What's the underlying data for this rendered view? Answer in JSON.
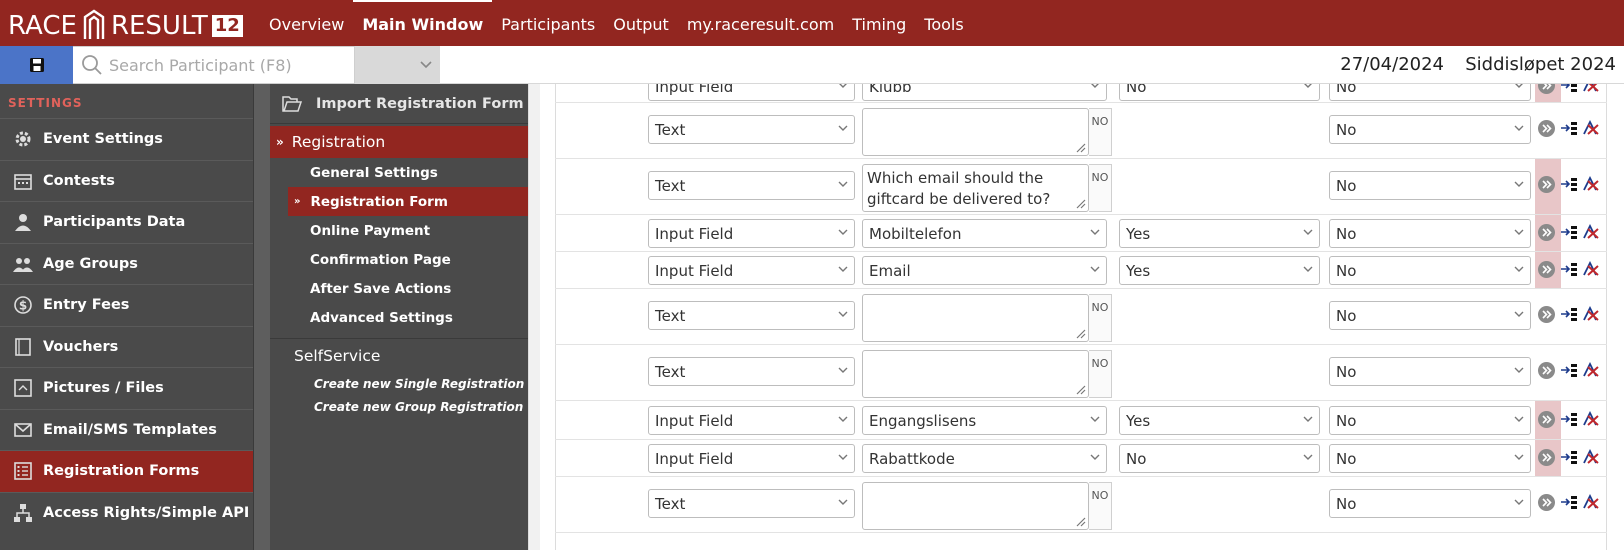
{
  "brand": {
    "logo_left": "RACE",
    "logo_right": "RESULT",
    "logo_version": "12"
  },
  "nav": [
    {
      "label": "Overview",
      "active": false
    },
    {
      "label": "Main Window",
      "active": true
    },
    {
      "label": "Participants",
      "active": false
    },
    {
      "label": "Output",
      "active": false
    },
    {
      "label": "my.raceresult.com",
      "active": false
    },
    {
      "label": "Timing",
      "active": false
    },
    {
      "label": "Tools",
      "active": false
    }
  ],
  "toolbar": {
    "search_placeholder": "Search Participant (F8)",
    "event_date": "27/04/2024",
    "event_name": "Siddisløpet 2024"
  },
  "sidebar": {
    "section": "SETTINGS",
    "items": [
      {
        "label": "Event Settings",
        "icon": "gear-icon"
      },
      {
        "label": "Contests",
        "icon": "calendar-icon"
      },
      {
        "label": "Participants Data",
        "icon": "person-icon"
      },
      {
        "label": "Age Groups",
        "icon": "group-icon"
      },
      {
        "label": "Entry Fees",
        "icon": "dollar-icon"
      },
      {
        "label": "Vouchers",
        "icon": "voucher-icon"
      },
      {
        "label": "Pictures / Files",
        "icon": "picture-icon"
      },
      {
        "label": "Email/SMS Templates",
        "icon": "envelope-icon"
      },
      {
        "label": "Registration Forms",
        "icon": "form-icon"
      },
      {
        "label": "Access Rights/Simple API",
        "icon": "hierarchy-icon"
      }
    ]
  },
  "subpanel": {
    "import_label": "Import Registration Form",
    "registration_label": "Registration",
    "items": [
      {
        "label": "General Settings"
      },
      {
        "label": "Registration Form"
      },
      {
        "label": "Online Payment"
      },
      {
        "label": "Confirmation Page"
      },
      {
        "label": "After Save Actions"
      },
      {
        "label": "Advanced Settings"
      }
    ],
    "selfservice_title": "SelfService",
    "links": [
      {
        "label": "Create new Single Registration form"
      },
      {
        "label": "Create new Group Registration form"
      }
    ]
  },
  "form_rows": [
    {
      "type": "Input Field",
      "field": "Klubb",
      "mandatory": "No",
      "hidden": "No"
    },
    {
      "type": "Text",
      "text": "",
      "no_label": "NO",
      "hidden": "No"
    },
    {
      "type": "Text",
      "text": "Which email should the giftcard be delivered to?",
      "no_label": "NO",
      "hidden": "No"
    },
    {
      "type": "Input Field",
      "field": "Mobiltelefon",
      "mandatory": "Yes",
      "hidden": "No"
    },
    {
      "type": "Input Field",
      "field": "Email",
      "mandatory": "Yes",
      "hidden": "No"
    },
    {
      "type": "Text",
      "text": "",
      "no_label": "NO",
      "hidden": "No"
    },
    {
      "type": "Text",
      "text": "",
      "no_label": "NO",
      "hidden": "No"
    },
    {
      "type": "Input Field",
      "field": "Engangslisens",
      "mandatory": "Yes",
      "hidden": "No"
    },
    {
      "type": "Input Field",
      "field": "Rabattkode",
      "mandatory": "No",
      "hidden": "No"
    },
    {
      "type": "Text",
      "text": "",
      "no_label": "NO",
      "hidden": "No"
    }
  ],
  "colors": {
    "brand_red": "#922620",
    "sidebar_bg": "#4a4a4a",
    "save_blue": "#4b74c8",
    "pink_highlight": "#e8c6c8"
  }
}
